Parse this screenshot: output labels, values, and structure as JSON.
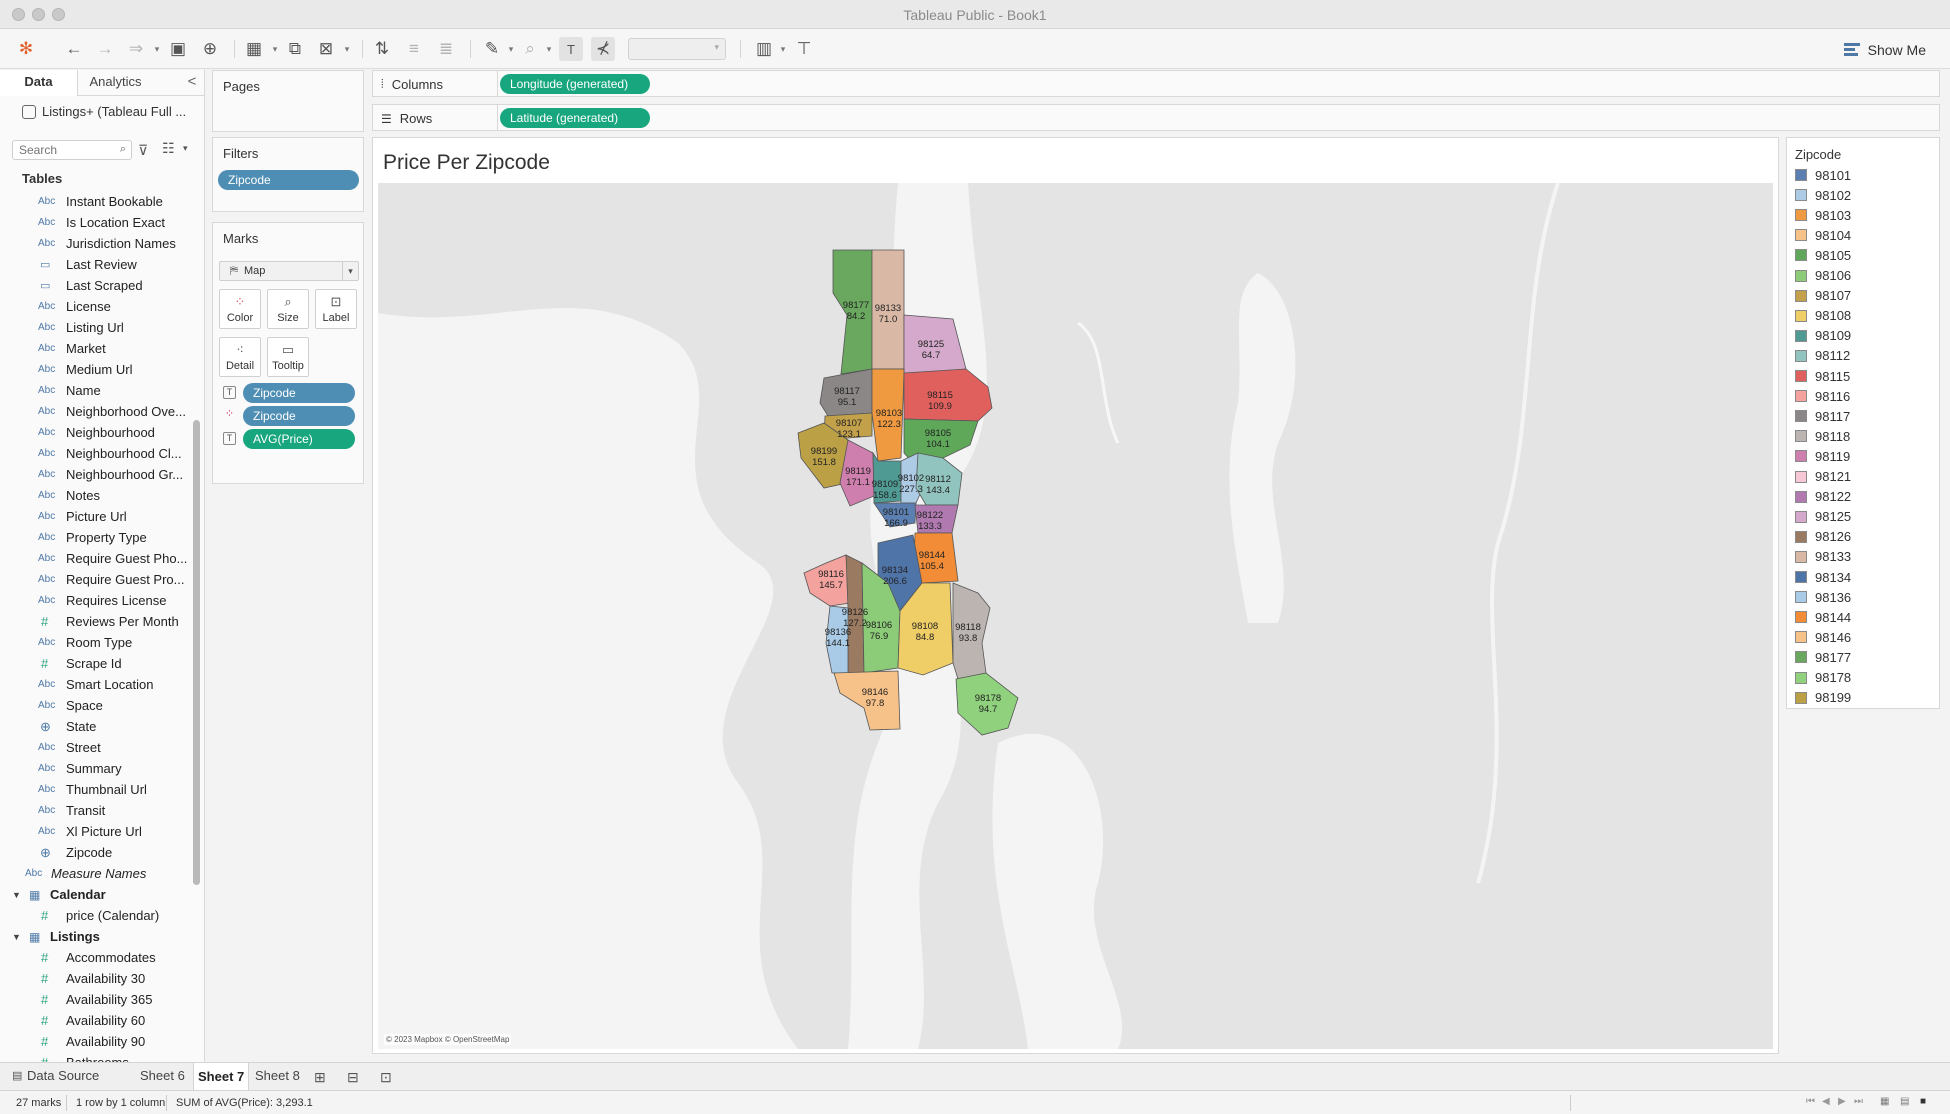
{
  "window": {
    "title": "Tableau Public - Book1"
  },
  "toolbar": {
    "show_me": "Show Me",
    "icons": [
      "tableau-logo-icon",
      "undo-icon",
      "redo-icon",
      "replay-icon",
      "save-icon",
      "new-datasource-icon",
      "new-worksheet-icon",
      "duplicate-icon",
      "clear-sheet-icon",
      "swap-icon",
      "sort-ascending-icon",
      "sort-descending-icon",
      "highlight-icon",
      "group-icon",
      "show-labels-icon",
      "fix-axes-icon",
      "fit-select",
      "chart-type-icon",
      "presentation-icon"
    ]
  },
  "data_pane": {
    "tabs": {
      "data": "Data",
      "analytics": "Analytics",
      "collapse": "<"
    },
    "datasource": "Listings+ (Tableau Full ...",
    "search_placeholder": "Search",
    "tables_heading": "Tables",
    "fields": [
      {
        "type": "Abc",
        "label": "Instant Bookable"
      },
      {
        "type": "Abc",
        "label": "Is Location Exact"
      },
      {
        "type": "Abc",
        "label": "Jurisdiction Names"
      },
      {
        "type": "date",
        "label": "Last Review"
      },
      {
        "type": "date",
        "label": "Last Scraped"
      },
      {
        "type": "Abc",
        "label": "License"
      },
      {
        "type": "Abc",
        "label": "Listing Url"
      },
      {
        "type": "Abc",
        "label": "Market"
      },
      {
        "type": "Abc",
        "label": "Medium Url"
      },
      {
        "type": "Abc",
        "label": "Name"
      },
      {
        "type": "Abc",
        "label": "Neighborhood Ove..."
      },
      {
        "type": "Abc",
        "label": "Neighbourhood"
      },
      {
        "type": "Abc",
        "label": "Neighbourhood Cl..."
      },
      {
        "type": "Abc",
        "label": "Neighbourhood Gr..."
      },
      {
        "type": "Abc",
        "label": "Notes"
      },
      {
        "type": "Abc",
        "label": "Picture Url"
      },
      {
        "type": "Abc",
        "label": "Property Type"
      },
      {
        "type": "Abc",
        "label": "Require Guest Pho..."
      },
      {
        "type": "Abc",
        "label": "Require Guest Pro..."
      },
      {
        "type": "Abc",
        "label": "Requires License"
      },
      {
        "type": "#",
        "label": "Reviews Per Month"
      },
      {
        "type": "Abc",
        "label": "Room Type"
      },
      {
        "type": "#",
        "label": "Scrape Id"
      },
      {
        "type": "Abc",
        "label": "Smart Location"
      },
      {
        "type": "Abc",
        "label": "Space"
      },
      {
        "type": "geo",
        "label": "State"
      },
      {
        "type": "Abc",
        "label": "Street"
      },
      {
        "type": "Abc",
        "label": "Summary"
      },
      {
        "type": "Abc",
        "label": "Thumbnail Url"
      },
      {
        "type": "Abc",
        "label": "Transit"
      },
      {
        "type": "Abc",
        "label": "Xl Picture Url"
      },
      {
        "type": "geo",
        "label": "Zipcode"
      },
      {
        "type": "Abc",
        "label": "Measure Names",
        "italic": true
      },
      {
        "type": "group",
        "label": "Calendar"
      },
      {
        "type": "#",
        "label": "price (Calendar)"
      },
      {
        "type": "group",
        "label": "Listings"
      },
      {
        "type": "#",
        "label": "Accommodates"
      },
      {
        "type": "#",
        "label": "Availability 30"
      },
      {
        "type": "#",
        "label": "Availability 365"
      },
      {
        "type": "#",
        "label": "Availability 60"
      },
      {
        "type": "#",
        "label": "Availability 90"
      },
      {
        "type": "#",
        "label": "Bathrooms"
      }
    ]
  },
  "cards": {
    "pages": "Pages",
    "filters": "Filters",
    "filter_pill": "Zipcode",
    "marks": "Marks",
    "mark_type": "Map",
    "mark_buttons": {
      "color": "Color",
      "size": "Size",
      "label": "Label",
      "detail": "Detail",
      "tooltip": "Tooltip"
    },
    "mark_pills": [
      {
        "icon": "label",
        "label": "Zipcode",
        "kind": "blue"
      },
      {
        "icon": "color",
        "label": "Zipcode",
        "kind": "blue"
      },
      {
        "icon": "label",
        "label": "AVG(Price)",
        "kind": "green"
      }
    ]
  },
  "shelves": {
    "columns_label": "Columns",
    "columns_pill": "Longitude (generated)",
    "rows_label": "Rows",
    "rows_pill": "Latitude (generated)"
  },
  "viz": {
    "title": "Price Per Zipcode",
    "attribution": "© 2023 Mapbox © OpenStreetMap",
    "regions": [
      {
        "zip": "98177",
        "value": "84.2",
        "color": "#6aa85f"
      },
      {
        "zip": "98133",
        "value": "71.0",
        "color": "#d9b9a6"
      },
      {
        "zip": "98125",
        "value": "64.7",
        "color": "#d4a9cb"
      },
      {
        "zip": "98117",
        "value": "95.1",
        "color": "#8a8786"
      },
      {
        "zip": "98103",
        "value": "122.3",
        "color": "#ef9a40"
      },
      {
        "zip": "98115",
        "value": "109.9",
        "color": "#e0605e"
      },
      {
        "zip": "98107",
        "value": "123.1",
        "color": "#c3a14a"
      },
      {
        "zip": "98105",
        "value": "104.1",
        "color": "#5fa85a"
      },
      {
        "zip": "98199",
        "value": "151.8",
        "color": "#bba046"
      },
      {
        "zip": "98119",
        "value": "171.1",
        "color": "#cf7fae"
      },
      {
        "zip": "98109",
        "value": "158.6",
        "color": "#4f9b94"
      },
      {
        "zip": "98102",
        "value": "227.3",
        "color": "#aecbe6"
      },
      {
        "zip": "98112",
        "value": "143.4",
        "color": "#91c4be"
      },
      {
        "zip": "98101",
        "value": "166.9",
        "color": "#5b7fb0"
      },
      {
        "zip": "98122",
        "value": "133.3",
        "color": "#b07ab0"
      },
      {
        "zip": "98144",
        "value": "105.4",
        "color": "#f28c36"
      },
      {
        "zip": "98134",
        "value": "206.6",
        "color": "#4f74a8"
      },
      {
        "zip": "98116",
        "value": "145.7",
        "color": "#f4a29e"
      },
      {
        "zip": "98126",
        "value": "127.2",
        "color": "#9b7a62"
      },
      {
        "zip": "98136",
        "value": "144.1",
        "color": "#a9cbe8"
      },
      {
        "zip": "98106",
        "value": "76.9",
        "color": "#8ccb78"
      },
      {
        "zip": "98108",
        "value": "84.8",
        "color": "#efcd67"
      },
      {
        "zip": "98118",
        "value": "93.8",
        "color": "#bcb4b1"
      },
      {
        "zip": "98146",
        "value": "97.8",
        "color": "#f7c28a"
      },
      {
        "zip": "98178",
        "value": "94.7",
        "color": "#8fd17c"
      }
    ]
  },
  "legend": {
    "title": "Zipcode",
    "items": [
      {
        "label": "98101",
        "color": "#5b7fb0"
      },
      {
        "label": "98102",
        "color": "#aecbe6"
      },
      {
        "label": "98103",
        "color": "#ef9a40"
      },
      {
        "label": "98104",
        "color": "#f7c28a"
      },
      {
        "label": "98105",
        "color": "#5fa85a"
      },
      {
        "label": "98106",
        "color": "#8ccb78"
      },
      {
        "label": "98107",
        "color": "#c3a14a"
      },
      {
        "label": "98108",
        "color": "#efcd67"
      },
      {
        "label": "98109",
        "color": "#4f9b94"
      },
      {
        "label": "98112",
        "color": "#91c4be"
      },
      {
        "label": "98115",
        "color": "#e0605e"
      },
      {
        "label": "98116",
        "color": "#f4a29e"
      },
      {
        "label": "98117",
        "color": "#8a8786"
      },
      {
        "label": "98118",
        "color": "#bcb4b1"
      },
      {
        "label": "98119",
        "color": "#cf7fae"
      },
      {
        "label": "98121",
        "color": "#f6c8d6"
      },
      {
        "label": "98122",
        "color": "#b07ab0"
      },
      {
        "label": "98125",
        "color": "#d4a9cb"
      },
      {
        "label": "98126",
        "color": "#9b7a62"
      },
      {
        "label": "98133",
        "color": "#d9b9a6"
      },
      {
        "label": "98134",
        "color": "#4f74a8"
      },
      {
        "label": "98136",
        "color": "#a9cbe8"
      },
      {
        "label": "98144",
        "color": "#f28c36"
      },
      {
        "label": "98146",
        "color": "#f7c28a"
      },
      {
        "label": "98177",
        "color": "#6aa85f"
      },
      {
        "label": "98178",
        "color": "#8fd17c"
      },
      {
        "label": "98199",
        "color": "#bba046"
      }
    ]
  },
  "sheet_tabs": {
    "data_source": "Data Source",
    "sheets": [
      "Sheet 6",
      "Sheet 7",
      "Sheet 8"
    ],
    "active": "Sheet 7"
  },
  "status": {
    "marks": "27 marks",
    "rows": "1 row by 1 column",
    "sum": "SUM of AVG(Price): 3,293.1"
  }
}
